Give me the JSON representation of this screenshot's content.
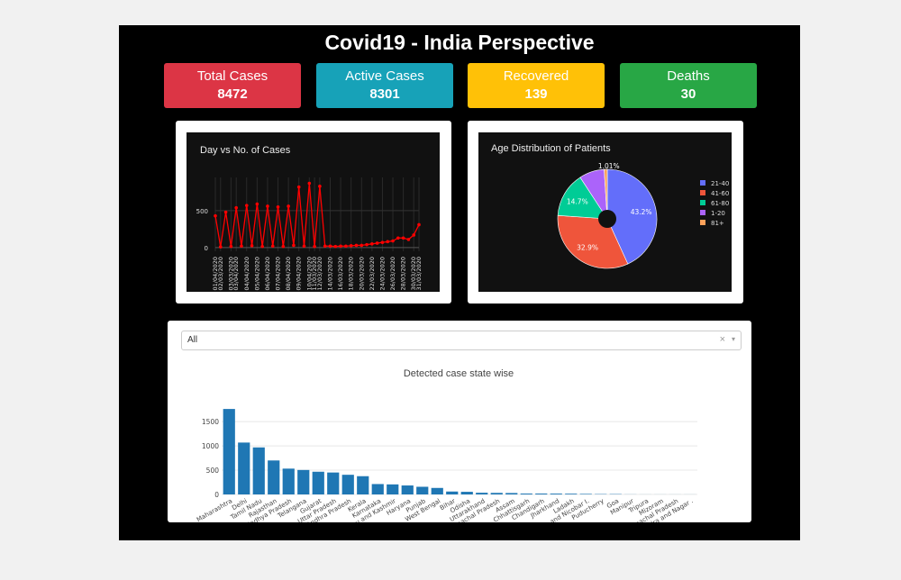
{
  "title": "Covid19 - India Perspective",
  "cards": [
    {
      "label": "Total Cases",
      "value": "8472",
      "color": "#dc3545"
    },
    {
      "label": "Active Cases",
      "value": "8301",
      "color": "#17a2b8"
    },
    {
      "label": "Recovered",
      "value": "139",
      "color": "#ffc107"
    },
    {
      "label": "Deaths",
      "value": "30",
      "color": "#28a745"
    }
  ],
  "day_chart": {
    "title": "Day vs No. of Cases",
    "yticks": [
      "0",
      "500"
    ],
    "line_color": "#ff0000"
  },
  "age_chart": {
    "title": "Age Distribution of Patients",
    "labels_shown": [
      "43.2%",
      "32.9%",
      "14.7%",
      "1.01%"
    ]
  },
  "state_panel": {
    "dropdown_value": "All",
    "clear_glyph": "×",
    "arrow_glyph": "▾"
  },
  "chart_data": [
    {
      "type": "line",
      "title": "Day vs No. of Cases",
      "x": [
        "01/04/2020",
        "02/03/2020",
        "02/04/2020",
        "03/03/2020",
        "03/04/2020",
        "04/03/2020",
        "04/04/2020",
        "05/03/2020",
        "05/04/2020",
        "06/03/2020",
        "06/04/2020",
        "07/03/2020",
        "07/04/2020",
        "08/03/2020",
        "08/04/2020",
        "09/03/2020",
        "09/04/2020",
        "10/03/2020",
        "10/04/2020",
        "11/03/2020",
        "12/03/2020",
        "13/03/2020",
        "14/03/2020",
        "15/03/2020",
        "16/03/2020",
        "17/03/2020",
        "18/03/2020",
        "19/03/2020",
        "20/03/2020",
        "21/03/2020",
        "22/03/2020",
        "23/03/2020",
        "24/03/2020",
        "25/03/2020",
        "26/03/2020",
        "27/03/2020",
        "28/03/2020",
        "29/03/2020",
        "30/03/2020",
        "31/03/2020"
      ],
      "x_tick_labels": [
        "01/04/2020",
        "02/03/2020",
        "03/03/2020",
        "03/04/2020",
        "04/04/2020",
        "05/04/2020",
        "06/04/2020",
        "07/04/2020",
        "08/04/2020",
        "09/04/2020",
        "10/04/2020",
        "11/03/2020",
        "12/03/2020",
        "14/03/2020",
        "16/03/2020",
        "18/03/2020",
        "20/03/2020",
        "22/03/2020",
        "24/03/2020",
        "26/03/2020",
        "28/03/2020",
        "30/03/2020",
        "31/03/2020"
      ],
      "values": [
        430,
        10,
        480,
        15,
        540,
        20,
        570,
        25,
        590,
        15,
        560,
        20,
        550,
        15,
        560,
        30,
        820,
        20,
        870,
        15,
        830,
        20,
        20,
        15,
        20,
        20,
        25,
        30,
        30,
        40,
        50,
        60,
        70,
        80,
        90,
        130,
        130,
        110,
        170,
        310
      ],
      "yticks": [
        0,
        500
      ],
      "ylim": [
        -50,
        950
      ],
      "series_color": "#ff0000",
      "grid": true
    },
    {
      "type": "pie",
      "title": "Age Distribution of Patients",
      "labels": [
        "21-40",
        "41-60",
        "61-80",
        "1-20",
        "81+"
      ],
      "values": [
        43.2,
        32.9,
        14.7,
        8.2,
        1.01
      ],
      "colors": [
        "#636efa",
        "#ef553b",
        "#00cc96",
        "#ab63fa",
        "#ffa15a"
      ],
      "shown_labels": [
        "43.2%",
        "32.9%",
        "14.7%",
        "",
        "1.01%"
      ],
      "hole": true,
      "legend": "right"
    },
    {
      "type": "bar",
      "title": "Detected case state wise",
      "categories": [
        "Maharashtra",
        "Delhi",
        "Tamil Nadu",
        "Rajasthan",
        "Madhya Pradesh",
        "Telangana",
        "Gujarat",
        "Uttar Pradesh",
        "Andhra Pradesh",
        "Kerala",
        "Karnataka",
        "Jammu and Kashmir",
        "Haryana",
        "Punjab",
        "West Bengal",
        "Bihar",
        "Odisha",
        "Uttarakhand",
        "Himachal Pradesh",
        "Assam",
        "Chhattisgarh",
        "Chandigarh",
        "Jharkhand",
        "Ladakh",
        "Andaman and Nicobar I.",
        "Puducherry",
        "Goa",
        "Manipur",
        "Tripura",
        "Mizoram",
        "Arunachal Pradesh",
        "Dadra and Nagar ."
      ],
      "values": [
        1761,
        1069,
        969,
        700,
        532,
        504,
        468,
        452,
        405,
        376,
        214,
        207,
        185,
        158,
        134,
        60,
        54,
        35,
        32,
        29,
        18,
        18,
        17,
        15,
        11,
        7,
        7,
        2,
        1,
        1,
        1,
        1
      ],
      "yticks": [
        0,
        500,
        1000,
        1500
      ],
      "ylim": [
        0,
        1800
      ],
      "series_color": "#1f77b4",
      "grid": true
    }
  ]
}
